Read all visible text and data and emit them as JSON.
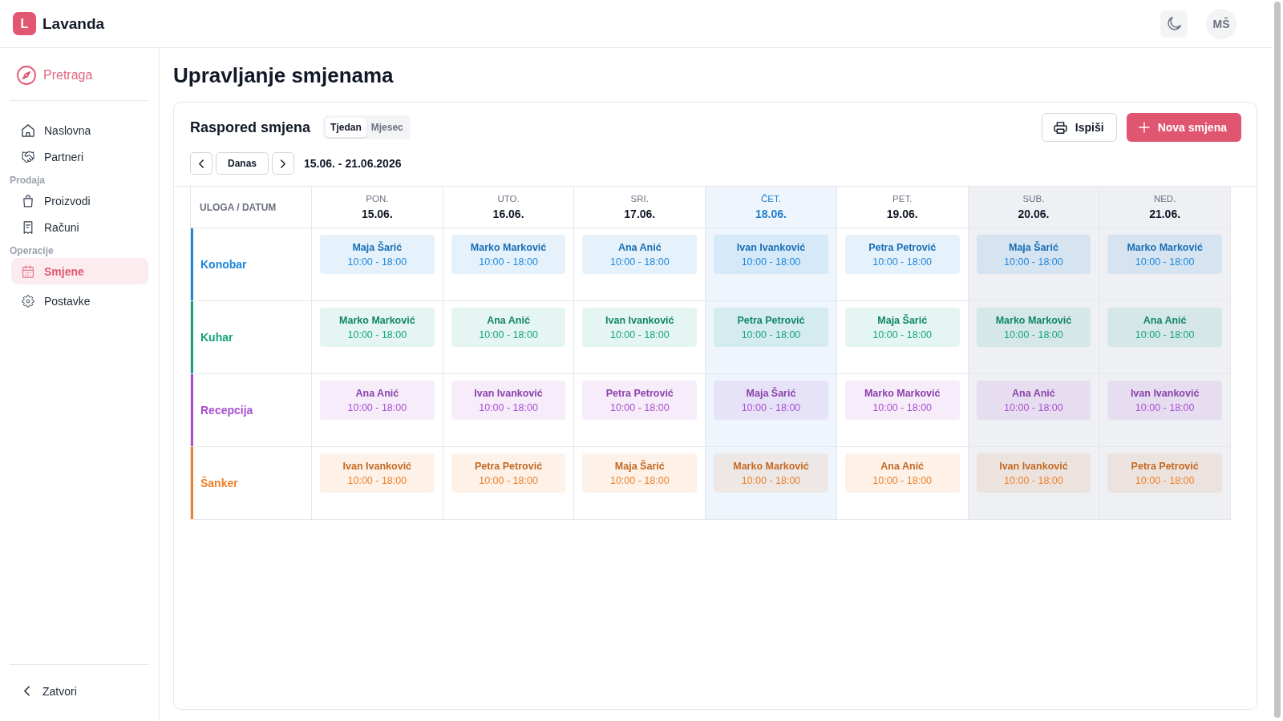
{
  "app": {
    "logo": "L",
    "name": "Lavanda"
  },
  "header": {
    "avatar": "MŠ"
  },
  "sidebar": {
    "search": "Pretraga",
    "sections": [
      {
        "items": [
          {
            "label": "Naslovna",
            "selected": false
          },
          {
            "label": "Partneri",
            "selected": false
          }
        ]
      },
      {
        "heading": "Prodaja",
        "items": [
          {
            "label": "Proizvodi",
            "selected": false
          },
          {
            "label": "Računi",
            "selected": false
          }
        ]
      },
      {
        "heading": "Operacije",
        "items": [
          {
            "label": "Smjene",
            "selected": true
          }
        ]
      },
      {
        "items": [
          {
            "label": "Postavke",
            "selected": false
          }
        ]
      }
    ],
    "close_button": "Zatvori"
  },
  "page_title": "Upravljanje smjenama",
  "schedule": {
    "title": "Raspored smjena",
    "view_tabs": [
      {
        "label": "Tjedan",
        "selected": true
      },
      {
        "label": "Mjesec",
        "selected": false
      }
    ],
    "print_button": "Ispiši",
    "new_button": "Nova smjena",
    "today_button": "Danas",
    "date_range": "15.06. - 21.06.2026",
    "corner_label": "ULOGA / DATUM",
    "days": [
      {
        "weekday": "PON.",
        "date": "15.06.",
        "today": false,
        "weekend": false
      },
      {
        "weekday": "UTO.",
        "date": "16.06.",
        "today": false,
        "weekend": false
      },
      {
        "weekday": "SRI.",
        "date": "17.06.",
        "today": false,
        "weekend": false
      },
      {
        "weekday": "ČET.",
        "date": "18.06.",
        "today": true,
        "weekend": false
      },
      {
        "weekday": "PET.",
        "date": "19.06.",
        "today": false,
        "weekend": false
      },
      {
        "weekday": "SUB.",
        "date": "20.06.",
        "today": false,
        "weekend": true
      },
      {
        "weekday": "NED.",
        "date": "21.06.",
        "today": false,
        "weekend": true
      }
    ],
    "roles": [
      {
        "name": "Konobar",
        "color": "#1e86dc",
        "shifts": [
          {
            "employee": "Maja Šarić",
            "time": "10:00 - 18:00"
          },
          {
            "employee": "Marko Marković",
            "time": "10:00 - 18:00"
          },
          {
            "employee": "Ana Anić",
            "time": "10:00 - 18:00"
          },
          {
            "employee": "Ivan Ivanković",
            "time": "10:00 - 18:00"
          },
          {
            "employee": "Petra Petrović",
            "time": "10:00 - 18:00"
          },
          {
            "employee": "Maja Šarić",
            "time": "10:00 - 18:00"
          },
          {
            "employee": "Marko Marković",
            "time": "10:00 - 18:00"
          }
        ]
      },
      {
        "name": "Kuhar",
        "color": "#14a47c",
        "shifts": [
          {
            "employee": "Marko Marković",
            "time": "10:00 - 18:00"
          },
          {
            "employee": "Ana Anić",
            "time": "10:00 - 18:00"
          },
          {
            "employee": "Ivan Ivanković",
            "time": "10:00 - 18:00"
          },
          {
            "employee": "Petra Petrović",
            "time": "10:00 - 18:00"
          },
          {
            "employee": "Maja Šarić",
            "time": "10:00 - 18:00"
          },
          {
            "employee": "Marko Marković",
            "time": "10:00 - 18:00"
          },
          {
            "employee": "Ana Anić",
            "time": "10:00 - 18:00"
          }
        ]
      },
      {
        "name": "Recepcija",
        "color": "#a94fd0",
        "shifts": [
          {
            "employee": "Ana Anić",
            "time": "10:00 - 18:00"
          },
          {
            "employee": "Ivan Ivanković",
            "time": "10:00 - 18:00"
          },
          {
            "employee": "Petra Petrović",
            "time": "10:00 - 18:00"
          },
          {
            "employee": "Maja Šarić",
            "time": "10:00 - 18:00"
          },
          {
            "employee": "Marko Marković",
            "time": "10:00 - 18:00"
          },
          {
            "employee": "Ana Anić",
            "time": "10:00 - 18:00"
          },
          {
            "employee": "Ivan Ivanković",
            "time": "10:00 - 18:00"
          }
        ]
      },
      {
        "name": "Šanker",
        "color": "#ee8029",
        "shifts": [
          {
            "employee": "Ivan Ivanković",
            "time": "10:00 - 18:00"
          },
          {
            "employee": "Petra Petrović",
            "time": "10:00 - 18:00"
          },
          {
            "employee": "Maja Šarić",
            "time": "10:00 - 18:00"
          },
          {
            "employee": "Marko Marković",
            "time": "10:00 - 18:00"
          },
          {
            "employee": "Ana Anić",
            "time": "10:00 - 18:00"
          },
          {
            "employee": "Ivan Ivanković",
            "time": "10:00 - 18:00"
          },
          {
            "employee": "Petra Petrović",
            "time": "10:00 - 18:00"
          }
        ]
      }
    ]
  }
}
